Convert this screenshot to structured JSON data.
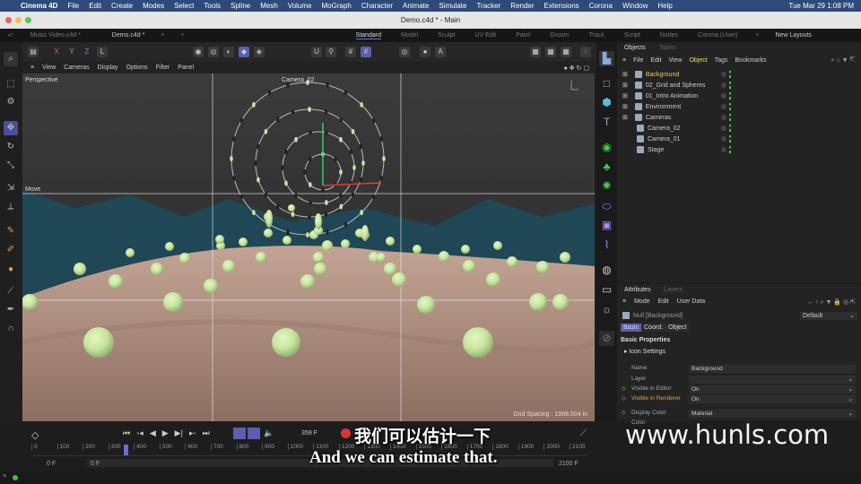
{
  "menubar": {
    "app": "Cinema 4D",
    "items": [
      "File",
      "Edit",
      "Create",
      "Modes",
      "Select",
      "Tools",
      "Spline",
      "Mesh",
      "Volume",
      "MoGraph",
      "Character",
      "Animate",
      "Simulate",
      "Tracker",
      "Render",
      "Extensions",
      "Corona",
      "Window",
      "Help"
    ],
    "clock": "Tue Mar 29  1:08 PM"
  },
  "window": {
    "title": "Demo.c4d * - Main"
  },
  "doc_tabs": [
    "Music Video.c4d *",
    "Demo.c4d *"
  ],
  "layouts": [
    "Standard",
    "Model",
    "Sculpt",
    "UV Edit",
    "Paint",
    "Groom",
    "Track",
    "Script",
    "Nodes",
    "Corona (User)"
  ],
  "new_layouts": "New Layouts",
  "toolbar": {
    "x": "X",
    "y": "Y",
    "z": "Z"
  },
  "viewport_menu": [
    "View",
    "Cameras",
    "Display",
    "Options",
    "Filter",
    "Panel"
  ],
  "viewport": {
    "label": "Perspective",
    "camera": "Camera_02",
    "tool": "Move",
    "grid_spacing": "Grid Spacing : 1968.504 in"
  },
  "objects": {
    "tabs": [
      "Objects",
      "Takes"
    ],
    "menu": [
      "File",
      "Edit",
      "View",
      "Object",
      "Tags",
      "Bookmarks"
    ],
    "items": [
      {
        "name": "Background",
        "selected": true
      },
      {
        "name": "02_Grid and Spheres"
      },
      {
        "name": "01_Intro Animation"
      },
      {
        "name": "Environment"
      },
      {
        "name": "Cameras"
      },
      {
        "name": "Camera_02",
        "child": true
      },
      {
        "name": "Camera_01",
        "child": true
      },
      {
        "name": "Stage",
        "child": true
      }
    ]
  },
  "attributes": {
    "tabs": [
      "Attributes",
      "Layers"
    ],
    "menu": [
      "Mode",
      "Edit",
      "User Data"
    ],
    "object": "Null [Background]",
    "preset": "Default",
    "subtabs": [
      "Basic",
      "Coord.",
      "Object"
    ],
    "section": "Basic Properties",
    "group": "Icon Settings",
    "fields": [
      {
        "label": "Name",
        "value": "Background"
      },
      {
        "label": "Layer",
        "value": ""
      },
      {
        "label": "Visible in Editor",
        "value": "On"
      },
      {
        "label": "Visible in Renderer",
        "value": "On"
      },
      {
        "label": "Display Color",
        "value": "Material"
      },
      {
        "label": "Color",
        "value": ""
      }
    ]
  },
  "timeline": {
    "current_frame": "359 F",
    "start": "0 F",
    "start2": "0 F",
    "end": "2100 F",
    "ticks": [
      "0",
      "100",
      "200",
      "300",
      "400",
      "500",
      "600",
      "700",
      "800",
      "900",
      "1000",
      "1100",
      "1200",
      "1300",
      "1400",
      "1500",
      "1600",
      "1700",
      "1800",
      "1900",
      "2000",
      "2100"
    ],
    "playhead_frame": 359,
    "max_frame": 2100
  },
  "subtitles": {
    "cn": "我们可以估计一下",
    "en": "And we can estimate that."
  },
  "watermark": "www.hunls.com",
  "colors": {
    "accent": "#5a5fb0",
    "selected_object": "#e8c860",
    "sphere": "#c8e6a0",
    "terrain": "#a8887a"
  }
}
